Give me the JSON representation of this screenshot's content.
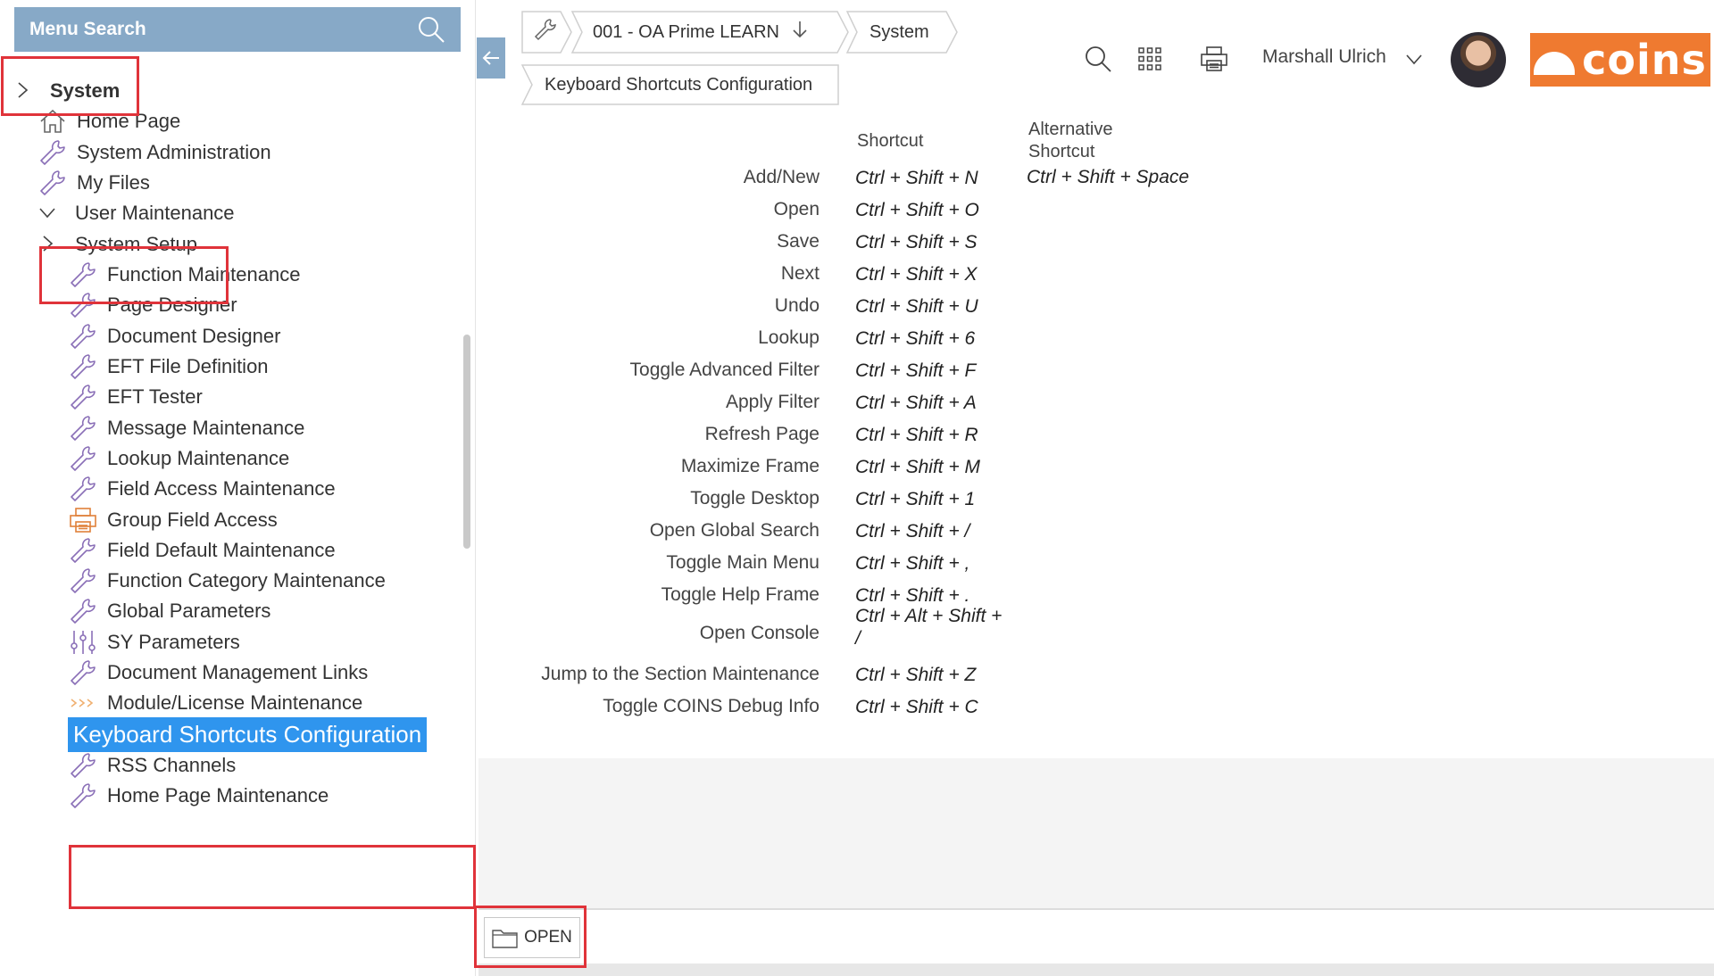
{
  "menu_search": {
    "label": "Menu Search"
  },
  "sidebar": {
    "items": [
      {
        "label": "System",
        "icon": "chevron-right-icon",
        "level": 0
      },
      {
        "label": "Home Page",
        "icon": "home-icon",
        "level": 1
      },
      {
        "label": "System Administration",
        "icon": "wrench-icon",
        "level": 1
      },
      {
        "label": "My Files",
        "icon": "wrench-icon",
        "level": 1
      },
      {
        "label": "User Maintenance",
        "icon": "chevron-down-icon",
        "level": 1
      },
      {
        "label": "System Setup",
        "icon": "chevron-right-icon",
        "level": 1
      },
      {
        "label": "Function Maintenance",
        "icon": "wrench-icon",
        "level": 2
      },
      {
        "label": "Page Designer",
        "icon": "wrench-icon",
        "level": 2
      },
      {
        "label": "Document Designer",
        "icon": "wrench-icon",
        "level": 2
      },
      {
        "label": "EFT File Definition",
        "icon": "wrench-icon",
        "level": 2
      },
      {
        "label": "EFT Tester",
        "icon": "wrench-icon",
        "level": 2
      },
      {
        "label": "Message Maintenance",
        "icon": "wrench-icon",
        "level": 2
      },
      {
        "label": "Lookup Maintenance",
        "icon": "wrench-icon",
        "level": 2
      },
      {
        "label": "Field Access Maintenance",
        "icon": "wrench-icon",
        "level": 2
      },
      {
        "label": "Group Field Access",
        "icon": "printer-icon",
        "level": 2
      },
      {
        "label": "Field Default Maintenance",
        "icon": "wrench-icon",
        "level": 2
      },
      {
        "label": "Function Category Maintenance",
        "icon": "wrench-icon",
        "level": 2
      },
      {
        "label": "Global Parameters",
        "icon": "wrench-icon",
        "level": 2
      },
      {
        "label": "SY Parameters",
        "icon": "sliders-icon",
        "level": 2
      },
      {
        "label": "Document Management Links",
        "icon": "wrench-icon",
        "level": 2
      },
      {
        "label": "Module/License Maintenance",
        "icon": "chevrons-icon",
        "level": 2
      },
      {
        "label": "Keyboard Shortcuts Configuration",
        "icon": "none",
        "level": 2,
        "selected": true
      },
      {
        "label": "RSS Channels",
        "icon": "wrench-icon",
        "level": 2
      },
      {
        "label": "Home Page Maintenance",
        "icon": "wrench-icon",
        "level": 2
      }
    ]
  },
  "breadcrumb": {
    "company": "001 - OA Prime LEARN",
    "module": "System",
    "page": "Keyboard Shortcuts Configuration"
  },
  "header": {
    "user_name": "Marshall Ulrich",
    "logo_text": "coins"
  },
  "shortcuts": {
    "col_shortcut": "Shortcut",
    "col_alternative_line1": "Alternative",
    "col_alternative_line2": "Shortcut",
    "rows": [
      {
        "action": "Add/New",
        "shortcut": "Ctrl + Shift + N",
        "alternative": "Ctrl + Shift + Space"
      },
      {
        "action": "Open",
        "shortcut": "Ctrl + Shift + O",
        "alternative": ""
      },
      {
        "action": "Save",
        "shortcut": "Ctrl + Shift + S",
        "alternative": ""
      },
      {
        "action": "Next",
        "shortcut": "Ctrl + Shift + X",
        "alternative": ""
      },
      {
        "action": "Undo",
        "shortcut": "Ctrl + Shift + U",
        "alternative": ""
      },
      {
        "action": "Lookup",
        "shortcut": "Ctrl + Shift + 6",
        "alternative": ""
      },
      {
        "action": "Toggle Advanced Filter",
        "shortcut": "Ctrl + Shift + F",
        "alternative": ""
      },
      {
        "action": "Apply Filter",
        "shortcut": "Ctrl + Shift + A",
        "alternative": ""
      },
      {
        "action": "Refresh Page",
        "shortcut": "Ctrl + Shift + R",
        "alternative": ""
      },
      {
        "action": "Maximize Frame",
        "shortcut": "Ctrl + Shift + M",
        "alternative": ""
      },
      {
        "action": "Toggle Desktop",
        "shortcut": "Ctrl + Shift + 1",
        "alternative": ""
      },
      {
        "action": "Open Global Search",
        "shortcut": "Ctrl + Shift + /",
        "alternative": ""
      },
      {
        "action": "Toggle Main Menu",
        "shortcut": "Ctrl + Shift + ,",
        "alternative": ""
      },
      {
        "action": "Toggle Help Frame",
        "shortcut": "Ctrl + Shift + .",
        "alternative": ""
      },
      {
        "action": "Open Console",
        "shortcut": "Ctrl + Alt + Shift +",
        "shortcut_line2": "/",
        "alternative": ""
      },
      {
        "action": "Jump to the Section Maintenance",
        "shortcut": "Ctrl + Shift + Z",
        "alternative": ""
      },
      {
        "action": "Toggle COINS Debug Info",
        "shortcut": "Ctrl + Shift + C",
        "alternative": ""
      }
    ]
  },
  "footer": {
    "open_label": "OPEN"
  },
  "colors": {
    "accent": "#87a9c7",
    "selected": "#2f95ee",
    "highlight": "#e0333a",
    "brand": "#ef7a30",
    "icon": "#8a6fb7"
  }
}
